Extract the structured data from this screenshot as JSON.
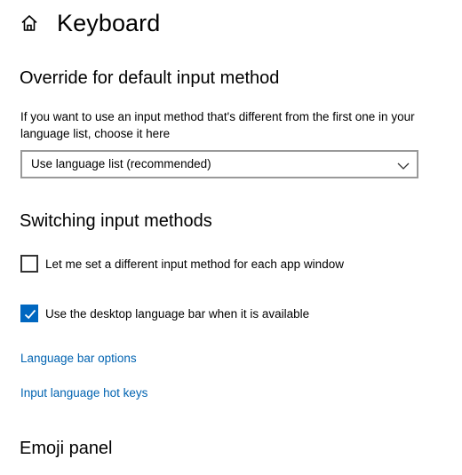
{
  "header": {
    "title": "Keyboard"
  },
  "override_section": {
    "title": "Override for default input method",
    "description": "If you want to use an input method that's different from the first one in your language list, choose it here",
    "dropdown": {
      "selected_value": "Use language list (recommended)"
    }
  },
  "switching_section": {
    "title": "Switching input methods",
    "checkboxes": [
      {
        "label": "Let me set a different input method for each app window",
        "checked": false
      },
      {
        "label": "Use the desktop language bar when it is available",
        "checked": true
      }
    ]
  },
  "links": {
    "language_bar_options": "Language bar options",
    "input_language_hot_keys": "Input language hot keys"
  },
  "emoji_section": {
    "title": "Emoji panel"
  },
  "colors": {
    "accent": "#0067c0",
    "link": "#0063b1",
    "dropdown_border": "#999999"
  },
  "icons": {
    "home": "home-icon",
    "dropdown": "chevron-down-icon",
    "check": "checkmark-icon"
  }
}
